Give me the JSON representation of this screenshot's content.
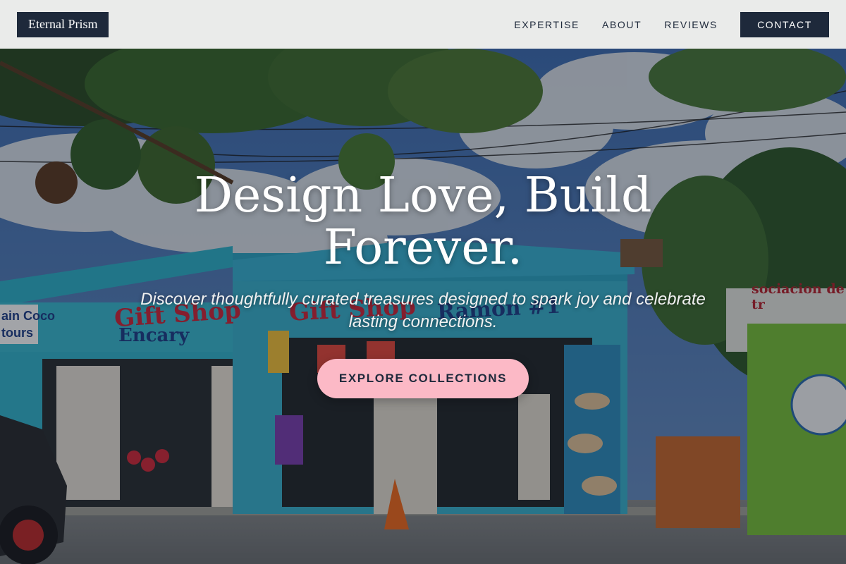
{
  "header": {
    "logo_text": "Eternal Prism",
    "nav": [
      "EXPERTISE",
      "ABOUT",
      "REVIEWS"
    ],
    "contact_label": "CONTACT"
  },
  "hero": {
    "title": "Design Love, Build Forever.",
    "subtitle": "Discover thoughtfully curated treasures designed to spark joy and celebrate lasting connections.",
    "cta_label": "EXPLORE COLLECTIONS"
  },
  "scene_signs": {
    "gift_shop_left": "Gift Shop",
    "encary": "Encary",
    "gift_shop_middle": "Gift Shop",
    "ramon": "Ramon #1",
    "coco_tours": "ain Coco\ntours",
    "asociacion": "sociacion de tr"
  },
  "colors": {
    "brand_dark": "#1e293b",
    "cta_pink": "#fcb9c6",
    "shop_turquoise": "#2fb3cc",
    "kiosk_green": "#7ac23a"
  }
}
